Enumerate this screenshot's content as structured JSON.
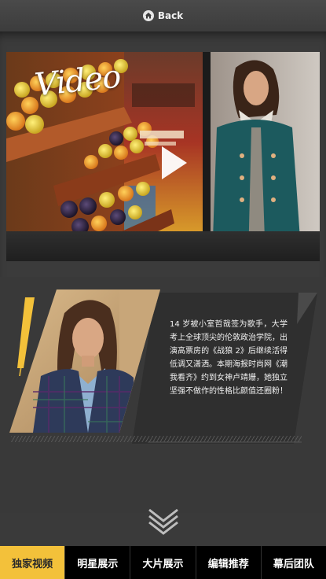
{
  "header": {
    "back_label": "Back",
    "back_icon": "home-icon"
  },
  "video": {
    "script_title": "Video",
    "play_icon": "play-icon"
  },
  "profile": {
    "bio": "14 岁被小室哲哉签为歌手，大学考上全球顶尖的伦敦政治学院，出演高票房的《战狼 2》后继续活得低调又潇洒。本期海报时尚网《潮我看齐》约到女神卢靖姗，她独立坚强不做作的性格比颜值还圈粉！",
    "accent_color": "#f3c13a"
  },
  "nav": {
    "items": [
      {
        "label": "独家视频",
        "active": true
      },
      {
        "label": "明星展示",
        "active": false
      },
      {
        "label": "大片展示",
        "active": false
      },
      {
        "label": "编辑推荐",
        "active": false
      },
      {
        "label": "幕后团队",
        "active": false
      }
    ]
  },
  "colors": {
    "active_tab": "#f3c13a",
    "background": "#3a3a3a",
    "nav_bg": "#000000"
  }
}
